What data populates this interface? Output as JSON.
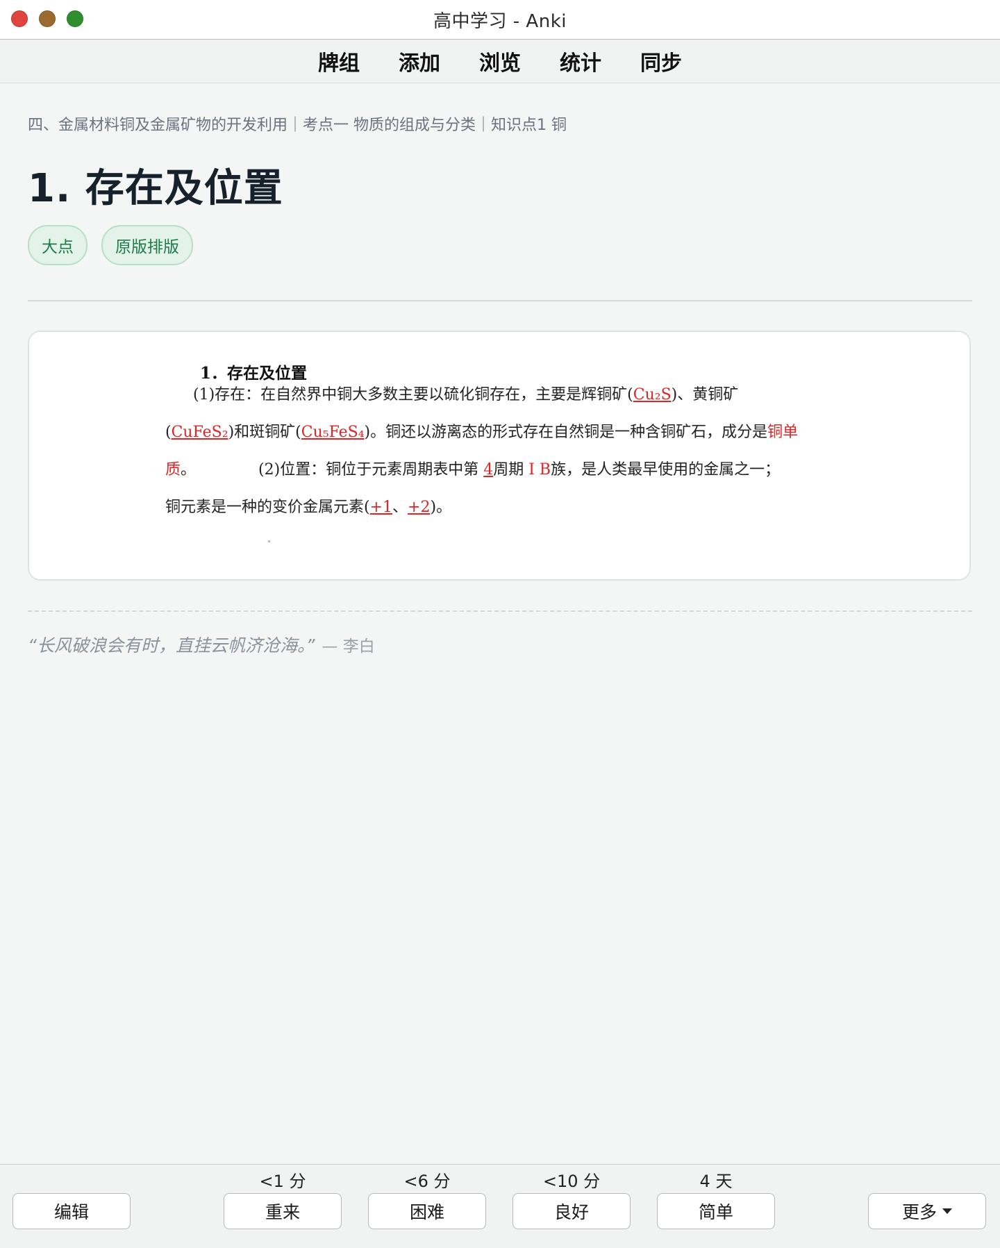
{
  "window": {
    "title": "高中学习 - Anki"
  },
  "toolbar": {
    "items": [
      "牌组",
      "添加",
      "浏览",
      "统计",
      "同步"
    ]
  },
  "breadcrumb": "四、金属材料铜及金属矿物的开发利用｜考点一 物质的组成与分类｜知识点1 铜",
  "page_title": "1.  存在及位置",
  "tags": [
    "大点",
    "原版排版"
  ],
  "card": {
    "title": "1．存在及位置",
    "line1": {
      "pre": "(1)存在：在自然界中铜大多数主要以硫化铜存在，主要是辉铜矿(",
      "a": "Cu₂S",
      "post": ")、黄铜矿"
    },
    "line2": {
      "a": "CuFeS₂",
      "mid": ")和斑铜矿(",
      "b": "Cu₅FeS₄",
      "post": ")。铜还以游离态的形式存在自然铜是一种含铜矿石，成分是",
      "c": "铜单"
    },
    "line3": {
      "c": "质",
      "pre": "。",
      "p2": "(2)位置：铜位于元素周期表中第 ",
      "n": "4",
      "mid": "周期 ",
      "g": "Ⅰ B",
      "post": "族，是人类最早使用的金属之一；"
    },
    "line4": {
      "pre": "铜元素是一种的变价金属元素(",
      "a": "+1",
      "sep": "、",
      "b": "+2",
      "post": ")。"
    }
  },
  "quote": {
    "text": "“长风破浪会有时，直挂云帆济沧海。”",
    "author": "— 李白"
  },
  "answer": {
    "edit_label": "编辑",
    "buttons": [
      {
        "interval": "<1 分",
        "label": "重来"
      },
      {
        "interval": "<6 分",
        "label": "困难"
      },
      {
        "interval": "<10 分",
        "label": "良好"
      },
      {
        "interval": "4 天",
        "label": "简单"
      }
    ],
    "more_label": "更多"
  },
  "colors": {
    "accent_red": "#e02424",
    "tag_green": "#1e7a4a"
  },
  "icons": {
    "more_menu": "caret-down-icon"
  }
}
